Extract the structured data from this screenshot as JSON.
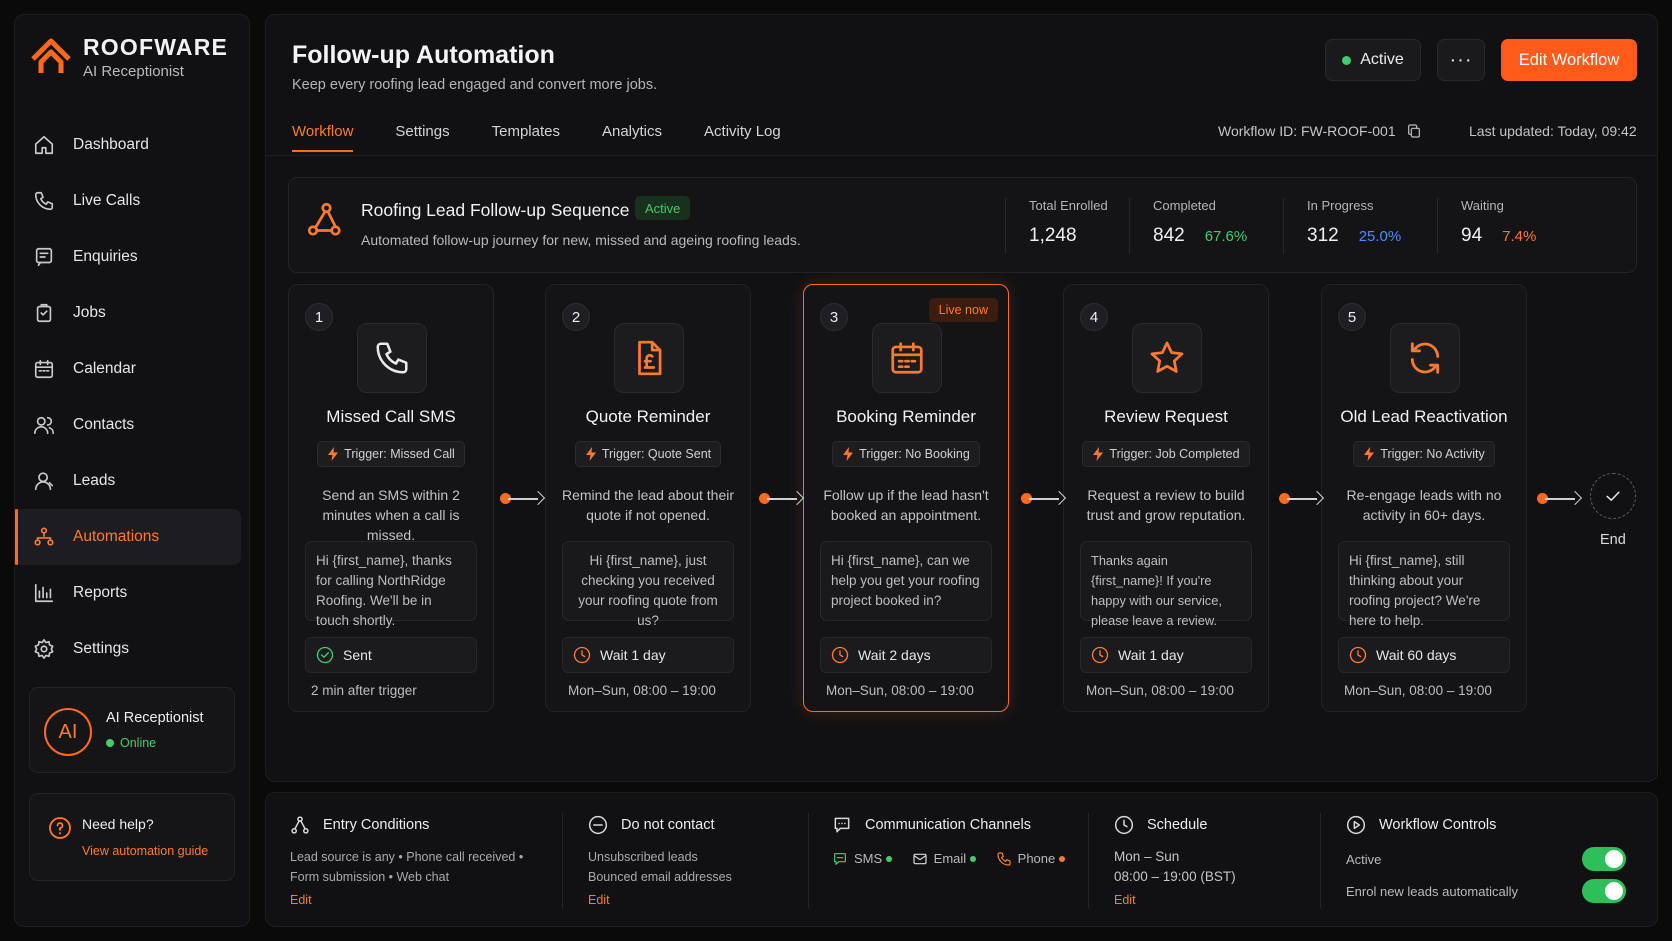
{
  "brand": {
    "name": "ROOFWARE",
    "subtitle": "AI Receptionist"
  },
  "sidebar": {
    "items": [
      {
        "label": "Dashboard",
        "icon": "home-icon"
      },
      {
        "label": "Live Calls",
        "icon": "phone-icon"
      },
      {
        "label": "Enquiries",
        "icon": "message-icon"
      },
      {
        "label": "Jobs",
        "icon": "clipboard-icon"
      },
      {
        "label": "Calendar",
        "icon": "calendar-icon"
      },
      {
        "label": "Contacts",
        "icon": "users-icon"
      },
      {
        "label": "Leads",
        "icon": "user-icon"
      },
      {
        "label": "Automations",
        "icon": "automation-icon",
        "active": true
      },
      {
        "label": "Reports",
        "icon": "bar-chart-icon"
      },
      {
        "label": "Settings",
        "icon": "gear-icon"
      }
    ],
    "ai_card": {
      "avatar": "AI",
      "title": "AI Receptionist",
      "status": "Online"
    },
    "help": {
      "title": "Need help?",
      "link": "View automation guide"
    }
  },
  "header": {
    "title": "Follow-up Automation",
    "subtitle": "Keep every roofing lead engaged and convert more jobs.",
    "status": "Active",
    "more": "···",
    "edit": "Edit Workflow",
    "tabs": [
      "Workflow",
      "Settings",
      "Templates",
      "Analytics",
      "Activity Log"
    ],
    "workflow_id": "Workflow ID: FW-ROOF-001",
    "last_updated": "Last updated: Today, 09:42"
  },
  "summary": {
    "title": "Roofing Lead Follow-up Sequence",
    "badge": "Active",
    "description": "Automated follow-up journey for new, missed and ageing roofing leads.",
    "stats": [
      {
        "label": "Total Enrolled",
        "value": "1,248",
        "pct": ""
      },
      {
        "label": "Completed",
        "value": "842",
        "pct": "67.6%",
        "color": "#3fce6b"
      },
      {
        "label": "In Progress",
        "value": "312",
        "pct": "25.0%",
        "color": "#4a8cff"
      },
      {
        "label": "Waiting",
        "value": "94",
        "pct": "7.4%",
        "color": "#ff7a2e"
      }
    ]
  },
  "steps": [
    {
      "num": "1",
      "title": "Missed Call SMS",
      "trigger": "Trigger: Missed Call",
      "desc": "Send an SMS within 2 minutes when a call is missed.",
      "message": "Hi {first_name}, thanks for calling NorthRidge Roofing. We'll be in touch shortly.",
      "status": "Sent",
      "footer": "2 min after trigger",
      "icon": "phone-icon"
    },
    {
      "num": "2",
      "title": "Quote Reminder",
      "trigger": "Trigger: Quote Sent",
      "desc": "Remind the lead about their quote if not opened.",
      "message": "Hi {first_name}, just checking you received your roofing quote from us?",
      "status": "Wait 1 day",
      "footer": "Mon–Sun, 08:00 – 19:00",
      "icon": "pound-document-icon"
    },
    {
      "num": "3",
      "title": "Booking Reminder",
      "trigger": "Trigger: No Booking",
      "desc": "Follow up if the lead hasn't booked an appointment.",
      "message": "Hi {first_name}, can we help you get your roofing project booked in?",
      "status": "Wait 2 days",
      "footer": "Mon–Sun, 08:00 – 19:00",
      "live": "Live now",
      "icon": "calendar-icon"
    },
    {
      "num": "4",
      "title": "Review Request",
      "trigger": "Trigger: Job Completed",
      "desc": "Request a review to build trust and grow reputation.",
      "message": "Thanks again {first_name}! If you're happy with our service, please leave a review.",
      "status": "Wait 1 day",
      "footer": "Mon–Sun, 08:00 – 19:00",
      "icon": "star-icon"
    },
    {
      "num": "5",
      "title": "Old Lead Reactivation",
      "trigger": "Trigger: No Activity",
      "desc": "Re-engage leads with no activity in 60+ days.",
      "message": "Hi {first_name}, still thinking about your roofing project? We're here to help.",
      "status": "Wait 60 days",
      "footer": "Mon–Sun, 08:00 – 19:00",
      "icon": "refresh-icon"
    }
  ],
  "end_label": "End",
  "bottom": {
    "entry": {
      "title": "Entry Conditions",
      "line1": "Lead source is any • Phone call received •",
      "line2": "Form submission • Web chat",
      "link": "Edit"
    },
    "dnc": {
      "title": "Do not contact",
      "line1": "Unsubscribed leads",
      "line2": "Bounced email addresses",
      "link": "Edit"
    },
    "channels": {
      "title": "Communication Channels",
      "items": [
        {
          "label": "SMS",
          "dot": "#3fce6b"
        },
        {
          "label": "Email",
          "dot": "#3fce6b"
        },
        {
          "label": "Phone",
          "dot": "#ff7a2e"
        }
      ]
    },
    "schedule": {
      "title": "Schedule",
      "line1": "Mon – Sun",
      "line2": "08:00 – 19:00 (BST)",
      "link": "Edit"
    },
    "controls": {
      "title": "Workflow Controls",
      "items": [
        {
          "label": "Active",
          "on": true
        },
        {
          "label": "Enrol new leads automatically",
          "on": true
        }
      ]
    }
  },
  "colors": {
    "accent": "#ff6a1f",
    "success": "#3fce6b",
    "info": "#4a8cff"
  }
}
